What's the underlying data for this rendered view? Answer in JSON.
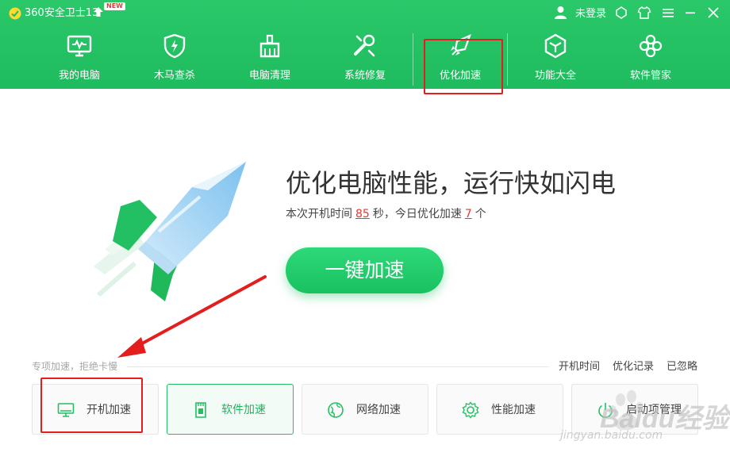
{
  "titlebar": {
    "app_title": "360安全卫士13",
    "new_badge": "NEW",
    "login_label": "未登录",
    "icons": [
      "user-icon",
      "skin-icon",
      "shirt-icon",
      "menu-icon",
      "minimize-icon",
      "close-icon"
    ]
  },
  "nav": {
    "items": [
      {
        "label": "我的电脑",
        "icon": "monitor-icon"
      },
      {
        "label": "木马查杀",
        "icon": "shield-icon"
      },
      {
        "label": "电脑清理",
        "icon": "broom-icon"
      },
      {
        "label": "系统修复",
        "icon": "wrench-icon"
      },
      {
        "label": "优化加速",
        "icon": "rocket-icon",
        "active": true
      },
      {
        "label": "功能大全",
        "icon": "cube-icon"
      },
      {
        "label": "软件管家",
        "icon": "apps-icon"
      }
    ]
  },
  "hero": {
    "headline": "优化电脑性能，运行快如闪电",
    "stats_prefix": "本次开机时间",
    "boot_seconds": "85",
    "stats_mid": "秒，今日优化加速",
    "optimized_count": "7",
    "stats_suffix": "个",
    "action_button": "一键加速"
  },
  "special": {
    "caption": "专项加速，拒绝卡慢",
    "links": {
      "boot_time": "开机时间",
      "history": "优化记录",
      "ignored": "已忽略"
    },
    "cards": [
      {
        "label": "开机加速",
        "icon": "monitor-icon"
      },
      {
        "label": "软件加速",
        "icon": "memory-card-icon",
        "active": true
      },
      {
        "label": "网络加速",
        "icon": "globe-icon"
      },
      {
        "label": "性能加速",
        "icon": "gear-icon"
      },
      {
        "label": "启动项管理",
        "icon": "power-icon"
      }
    ]
  },
  "watermark": {
    "brand": "Baidu经验",
    "url": "jingyan.baidu.com"
  },
  "colors": {
    "brand_green": "#1ebc5e",
    "accent_red": "#e23b2f",
    "annotation_red": "#e41d1d"
  }
}
